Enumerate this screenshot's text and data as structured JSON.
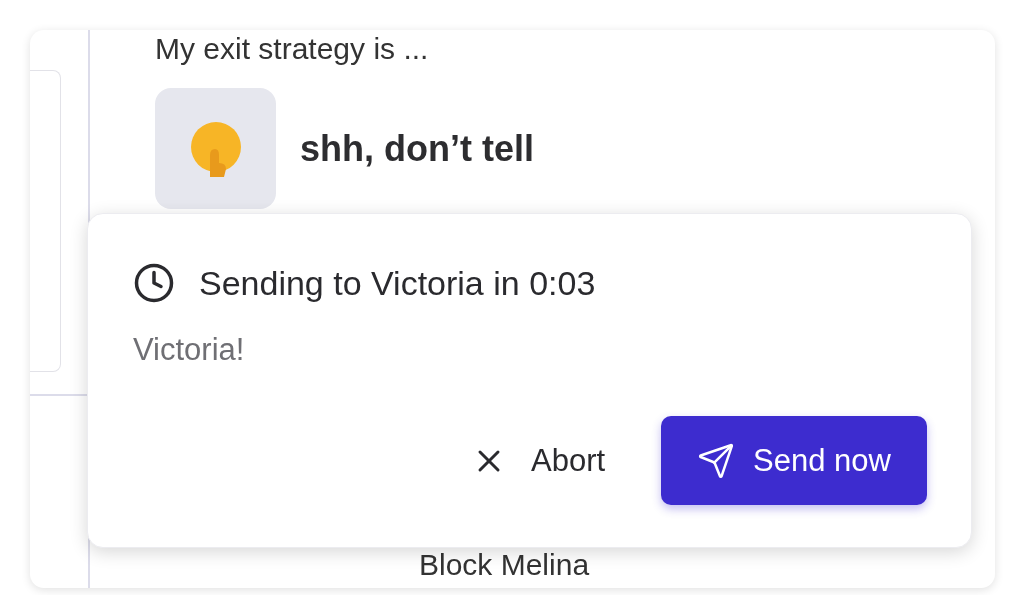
{
  "prompt": "My exit strategy is ...",
  "answer": {
    "text": "shh, don’t tell"
  },
  "next_item": "Block Melina",
  "toast": {
    "title": "Sending to Victoria in 0:03",
    "message": "Victoria!",
    "actions": [
      {
        "kind": "secondary",
        "label": "Abort"
      },
      {
        "kind": "primary",
        "label": "Send now"
      }
    ]
  }
}
